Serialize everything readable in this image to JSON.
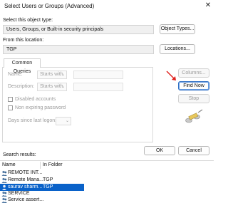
{
  "window": {
    "title": "Select Users or Groups (Advanced)"
  },
  "object_type": {
    "label": "Select this object type:",
    "value": "Users, Groups, or Built-in security principals",
    "button": "Object Types..."
  },
  "location": {
    "label": "From this location:",
    "value": "TGP",
    "button": "Locations..."
  },
  "common_queries": {
    "tab_label": "Common Queries",
    "name_label": "Name:",
    "name_mode": "Starts with",
    "description_label": "Description:",
    "description_mode": "Starts with",
    "disabled_accounts": "Disabled accounts",
    "non_expiring_password": "Non expiring password",
    "days_label": "Days since last logon:"
  },
  "side_buttons": {
    "columns": "Columns...",
    "find_now": "Find Now",
    "stop": "Stop"
  },
  "footer": {
    "ok": "OK",
    "cancel": "Cancel"
  },
  "results": {
    "label": "Search results:",
    "columns": [
      "Name",
      "In Folder"
    ],
    "rows": [
      {
        "name": "REMOTE INT...",
        "folder": ""
      },
      {
        "name": "Remote Mana...",
        "folder": "TGP"
      },
      {
        "name": "saurav sharm...",
        "folder": "TGP"
      },
      {
        "name": "SERVICE",
        "folder": ""
      },
      {
        "name": "Service assert...",
        "folder": ""
      }
    ]
  },
  "colors": {
    "selection": "#0a62c9",
    "annotation_arrow": "#e0201c"
  },
  "icons": [
    "close-icon",
    "search-binoculars-icon",
    "group-icon",
    "user-icon",
    "red-arrow-annotation"
  ]
}
